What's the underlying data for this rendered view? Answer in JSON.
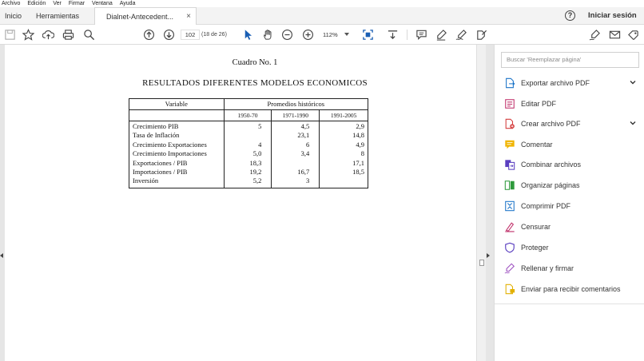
{
  "menu": [
    "Archivo",
    "Edición",
    "Ver",
    "Firmar",
    "Ventana",
    "Ayuda"
  ],
  "tabs": {
    "home": "Inicio",
    "tools": "Herramientas",
    "document": "Dialnet-Antecedent...",
    "close": "×"
  },
  "header": {
    "help": "?",
    "signin": "Iniciar sesión"
  },
  "toolbar": {
    "page_current": "102",
    "page_total": "(18 de 26)",
    "zoom": "112%"
  },
  "document": {
    "title": "Cuadro No. 1",
    "subtitle": "RESULTADOS DIFERENTES MODELOS ECONOMICOS",
    "table": {
      "header_variable": "Variable",
      "header_group": "Promedios históricos",
      "periods": [
        "1950-70",
        "1971-1990",
        "1991-2005"
      ],
      "rows": [
        {
          "label": "Crecimiento PIB",
          "values": [
            "5",
            "4,5",
            "2,9"
          ]
        },
        {
          "label": "Tasa de Inflación",
          "values": [
            "",
            "23,1",
            "14,8"
          ]
        },
        {
          "label": "Crecimiento Exportaciones",
          "values": [
            "4",
            "6",
            "4,9"
          ]
        },
        {
          "label": "Crecimiento Importaciones",
          "values": [
            "5,0",
            "3,4",
            "8"
          ]
        },
        {
          "label": "Exportaciones / PIB",
          "values": [
            "18,3",
            "",
            "17,1"
          ]
        },
        {
          "label": "Importaciones / PIB",
          "values": [
            "19,2",
            "16,7",
            "18,5"
          ]
        },
        {
          "label": "Inversión",
          "values": [
            "5,2",
            "3",
            ""
          ]
        }
      ]
    }
  },
  "right_pane": {
    "search_placeholder": "Buscar 'Reemplazar página'",
    "tools": [
      {
        "label": "Exportar archivo PDF",
        "icon": "export-pdf-icon",
        "color": "#1a73c8",
        "expandable": true
      },
      {
        "label": "Editar PDF",
        "icon": "edit-pdf-icon",
        "color": "#c0306a",
        "expandable": false
      },
      {
        "label": "Crear archivo PDF",
        "icon": "create-pdf-icon",
        "color": "#d43c3c",
        "expandable": true
      },
      {
        "label": "Comentar",
        "icon": "comment-icon",
        "color": "#f0b400",
        "expandable": false
      },
      {
        "label": "Combinar archivos",
        "icon": "combine-files-icon",
        "color": "#5a3fc0",
        "expandable": false
      },
      {
        "label": "Organizar páginas",
        "icon": "organize-pages-icon",
        "color": "#2e9a3c",
        "expandable": false
      },
      {
        "label": "Comprimir PDF",
        "icon": "compress-pdf-icon",
        "color": "#1a73c8",
        "expandable": false
      },
      {
        "label": "Censurar",
        "icon": "redact-icon",
        "color": "#c0306a",
        "expandable": false
      },
      {
        "label": "Proteger",
        "icon": "protect-icon",
        "color": "#5a3fc0",
        "expandable": false
      },
      {
        "label": "Rellenar y firmar",
        "icon": "fill-sign-icon",
        "color": "#9b4dbf",
        "expandable": false
      },
      {
        "label": "Enviar para recibir comentarios",
        "icon": "send-review-icon",
        "color": "#e2b000",
        "expandable": false
      }
    ]
  }
}
